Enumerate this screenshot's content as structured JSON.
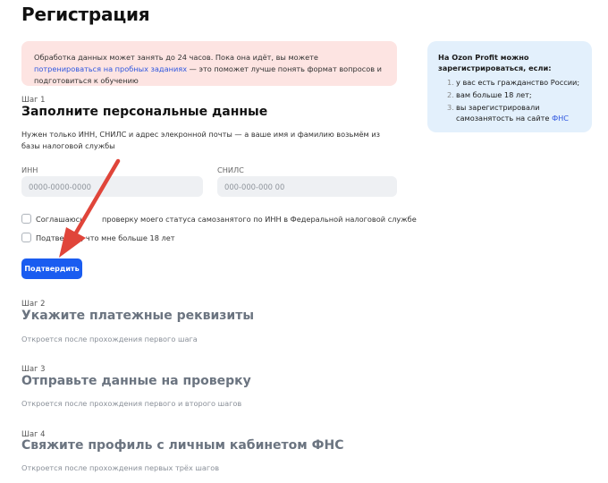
{
  "page": {
    "title": "Регистрация"
  },
  "notice": {
    "text_before": "Обработка данных может занять до 24 часов. Пока она идёт, вы можете ",
    "link_text": "потренироваться на пробных заданиях",
    "text_after": " — это поможет лучше понять формат вопросов и подготовиться к обучению"
  },
  "sidebar": {
    "heading": "На Ozon Profit можно зарегистрироваться, если:",
    "items": [
      {
        "num": "1.",
        "text": "у вас есть гражданство России;"
      },
      {
        "num": "2.",
        "text": "вам больше 18 лет;"
      },
      {
        "num": "3.",
        "text": "вы зарегистрировали самозанятость на сайте ",
        "link": "ФНС"
      }
    ]
  },
  "steps": [
    {
      "label": "Шаг 1",
      "title": "Заполните персональные данные",
      "description": "Нужен только ИНН, СНИЛС и адрес элекронной почты — а ваше имя и фамилию возьмём из базы налоговой службы"
    },
    {
      "label": "Шаг 2",
      "title": "Укажите платежные реквизиты",
      "note": "Откроется после прохождения первого шага"
    },
    {
      "label": "Шаг 3",
      "title": "Отправьте данные на проверку",
      "note": "Откроется после прохождения первого и второго шагов"
    },
    {
      "label": "Шаг 4",
      "title": "Свяжите профиль с личным кабинетом ФНС",
      "note": "Откроется после прохождения первых трёх шагов"
    }
  ],
  "form": {
    "inn": {
      "label": "ИНН",
      "placeholder": "0000-0000-0000",
      "value": ""
    },
    "snils": {
      "label": "СНИЛС",
      "placeholder": "000-000-000 00",
      "value": ""
    },
    "consent_check": {
      "label_start": "Соглашаюсь",
      "label_end": "проверку моего статуса самозанятого по ИНН в Федеральной налоговой службе",
      "checked": false
    },
    "age_check": {
      "label_start": "Подтвер",
      "label_end": ", что мне больше 18 лет",
      "checked": false
    },
    "submit_label": "Подтвердить"
  },
  "colors": {
    "accent": "#1a5cf0",
    "notice_bg": "#fde4e2",
    "sidebar_bg": "#e3f0fc",
    "arrow": "#e0453a"
  }
}
